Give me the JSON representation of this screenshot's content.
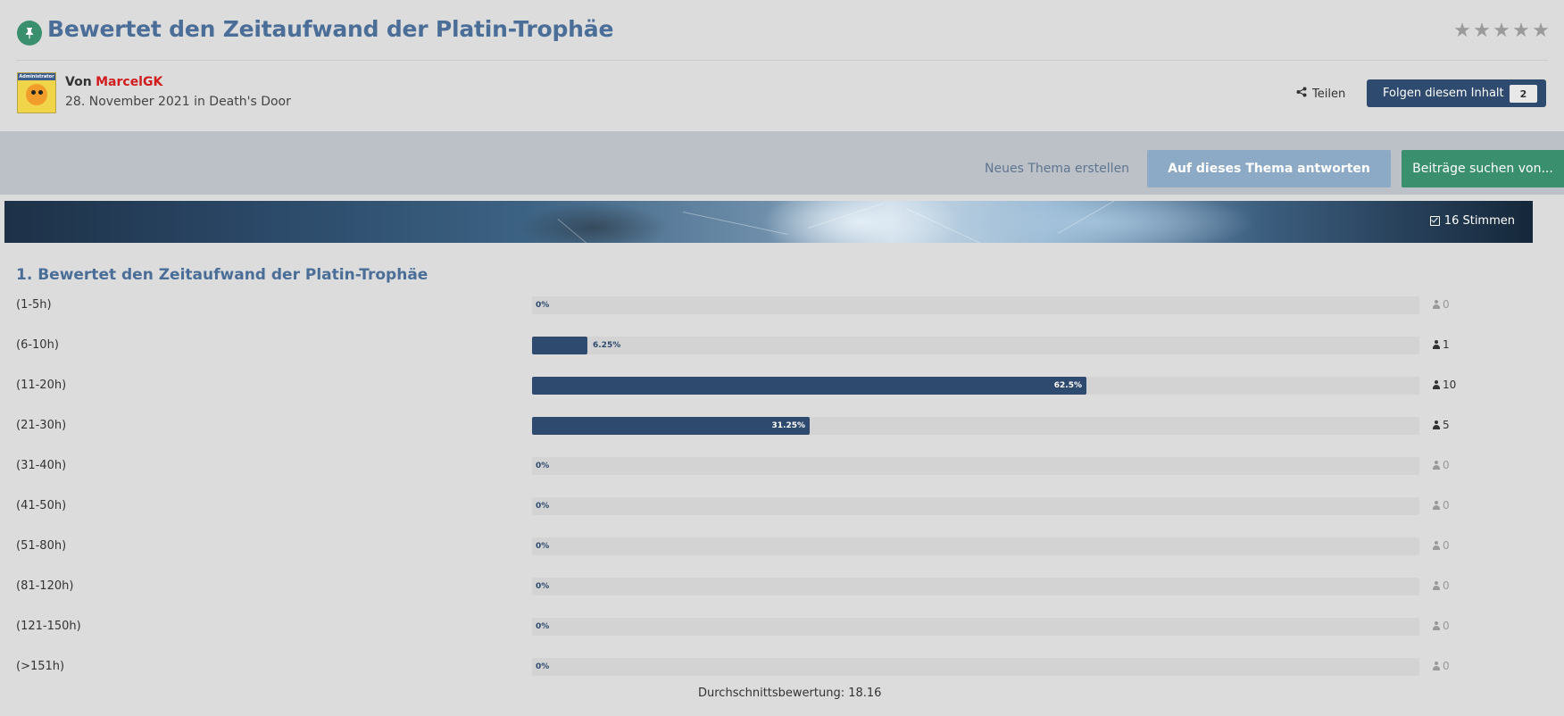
{
  "topic": {
    "title": "Bewertet den Zeitaufwand der Platin-Trophäe",
    "pin_icon": "pin-icon",
    "rating_stars": 5,
    "star_icon": "star-icon"
  },
  "author": {
    "prefix": "Von",
    "name": "MarcelGK",
    "avatar_badge": "Administrator",
    "date_line": "28. November 2021 in Death's Door"
  },
  "actions": {
    "share_label": "Teilen",
    "share_icon": "share-icon",
    "follow_label": "Folgen diesem Inhalt",
    "follow_count": "2",
    "new_topic_label": "Neues Thema erstellen",
    "reply_label": "Auf dieses Thema antworten",
    "search_label": "Beiträge suchen von..."
  },
  "banner": {
    "votes_label": "16 Stimmen",
    "votes_icon": "check-square-icon"
  },
  "poll": {
    "question_title": "1. Bewertet den Zeitaufwand der Platin-Trophäe",
    "options": [
      {
        "label": "(1-5h)",
        "percent": 0,
        "percent_label": "0%",
        "votes": "0"
      },
      {
        "label": "(6-10h)",
        "percent": 6.25,
        "percent_label": "6.25%",
        "votes": "1"
      },
      {
        "label": "(11-20h)",
        "percent": 62.5,
        "percent_label": "62.5%",
        "votes": "10"
      },
      {
        "label": "(21-30h)",
        "percent": 31.25,
        "percent_label": "31.25%",
        "votes": "5"
      },
      {
        "label": "(31-40h)",
        "percent": 0,
        "percent_label": "0%",
        "votes": "0"
      },
      {
        "label": "(41-50h)",
        "percent": 0,
        "percent_label": "0%",
        "votes": "0"
      },
      {
        "label": "(51-80h)",
        "percent": 0,
        "percent_label": "0%",
        "votes": "0"
      },
      {
        "label": "(81-120h)",
        "percent": 0,
        "percent_label": "0%",
        "votes": "0"
      },
      {
        "label": "(121-150h)",
        "percent": 0,
        "percent_label": "0%",
        "votes": "0"
      },
      {
        "label": "(>151h)",
        "percent": 0,
        "percent_label": "0%",
        "votes": "0"
      }
    ],
    "average_label": "Durchschnittsbewertung: 18.16"
  },
  "colors": {
    "title_blue": "#4a6e98",
    "bar_fill": "#2e4a6e",
    "bar_track": "#d3d3d3",
    "green": "#3a8f6e",
    "author_red": "#d01c1c"
  }
}
